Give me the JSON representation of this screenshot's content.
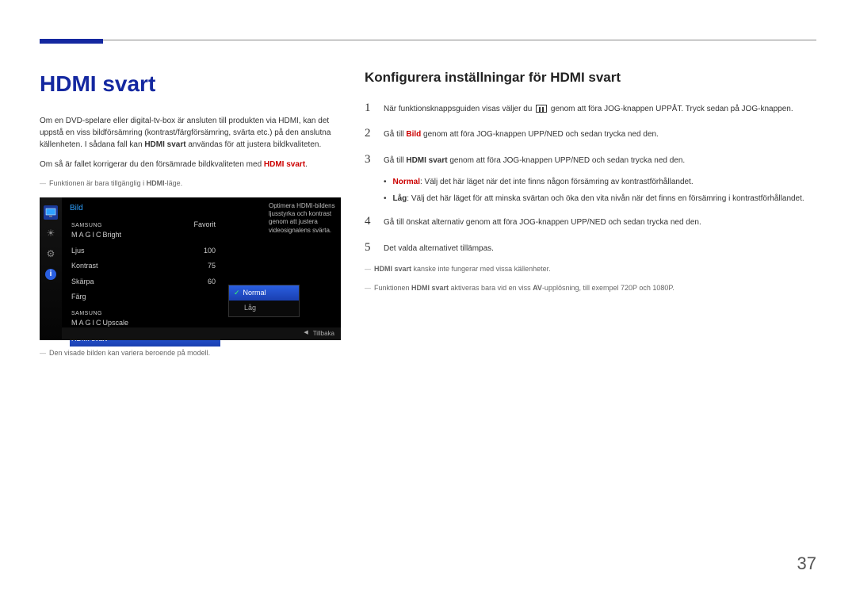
{
  "page_number": "37",
  "left": {
    "title": "HDMI svart",
    "para1_a": "Om en DVD-spelare eller digital-tv-box är ansluten till produkten via HDMI, kan det uppstå en viss bildförsämring (kontrast/färgförsämring, svärta etc.) på den anslutna källenheten. I sådana fall kan ",
    "para1_bold": "HDMI svart",
    "para1_b": " användas för att justera bildkvaliteten.",
    "para2_a": "Om så är fallet korrigerar du den försämrade bildkvaliteten med ",
    "para2_red": "HDMI svart",
    "para2_b": ".",
    "note1_a": "Funktionen är bara tillgänglig i ",
    "note1_bold": "HDMI",
    "note1_b": "-läge.",
    "caption": "Den visade bilden kan variera beroende på modell."
  },
  "osd": {
    "title": "Bild",
    "rows": [
      {
        "label_prefix": "SAMSUNG",
        "label_suffix": "Bright",
        "value": "Favorit"
      },
      {
        "label": "Ljus",
        "value": "100"
      },
      {
        "label": "Kontrast",
        "value": "75"
      },
      {
        "label": "Skärpa",
        "value": "60"
      },
      {
        "label": "Färg",
        "value": ""
      },
      {
        "label_prefix": "SAMSUNG",
        "label_suffix": "Upscale",
        "value": ""
      },
      {
        "label": "HDMI svart",
        "value": "",
        "selected": true
      }
    ],
    "popup": {
      "options": [
        {
          "label": "Normal",
          "selected": true
        },
        {
          "label": "Låg"
        }
      ]
    },
    "desc": "Optimera HDMI-bildens ljusstyrka och kontrast genom att justera videosignalens svärta.",
    "footer_back": "Tillbaka"
  },
  "right": {
    "title": "Konfigurera inställningar för HDMI svart",
    "steps": {
      "s1_a": "När funktionsknappsguiden visas väljer du ",
      "s1_b": " genom att föra JOG-knappen UPPÅT. Tryck sedan på JOG-knappen.",
      "s2_a": "Gå till ",
      "s2_red": "Bild",
      "s2_b": " genom att föra JOG-knappen UPP/NED och sedan trycka ned den.",
      "s3_a": "Gå till ",
      "s3_bold": "HDMI svart",
      "s3_b": " genom att föra JOG-knappen UPP/NED och sedan trycka ned den.",
      "bullet_normal_label": "Normal",
      "bullet_normal_text": ": Välj det här läget när det inte finns någon försämring av kontrastförhållandet.",
      "bullet_lag_label": "Låg",
      "bullet_lag_text": ": Välj det här läget för att minska svärtan och öka den vita nivån när det finns en försämring i kontrastförhållandet.",
      "s4": "Gå till önskat alternativ genom att föra JOG-knappen UPP/NED och sedan trycka ned den.",
      "s5": "Det valda alternativet tillämpas."
    },
    "note_a_bold": "HDMI svart",
    "note_a_text": " kanske inte fungerar med vissa källenheter.",
    "note_b_pre": "Funktionen ",
    "note_b_bold1": "HDMI svart",
    "note_b_mid": " aktiveras bara vid en viss ",
    "note_b_bold2": "AV",
    "note_b_post": "-upplösning, till exempel 720P och 1080P."
  }
}
